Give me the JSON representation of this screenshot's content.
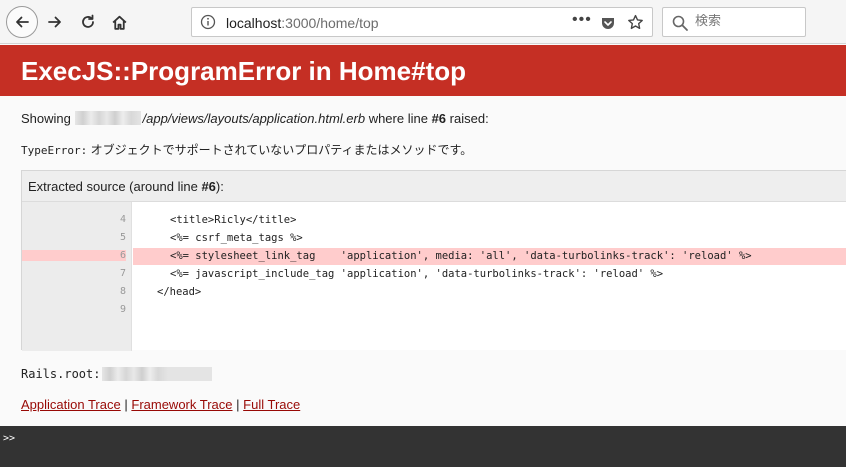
{
  "browser": {
    "url_host": "localhost",
    "url_path": ":3000/home/top",
    "more_label": "•••",
    "search_placeholder": "検索"
  },
  "error": {
    "title": "ExecJS::ProgramError in Home#top",
    "showing_prefix": "Showing",
    "template_path": "/app/views/layouts/application.html.erb",
    "where_text": "where line",
    "line_ref": "#6",
    "raised_text": "raised:",
    "type_label": "TypeError:",
    "message": "オブジェクトでサポートされていないプロパティまたはメソッドです。"
  },
  "source": {
    "caption_prefix": "Extracted source (around line ",
    "caption_line": "#6",
    "caption_suffix": "):",
    "lines": [
      {
        "num": "4",
        "code": "<title>Ricly</title>"
      },
      {
        "num": "5",
        "code": "<%= csrf_meta_tags %>"
      },
      {
        "num": "6",
        "code": "<%= stylesheet_link_tag    'application', media: 'all', 'data-turbolinks-track': 'reload' %>"
      },
      {
        "num": "7",
        "code": "<%= javascript_include_tag 'application', 'data-turbolinks-track': 'reload' %>"
      },
      {
        "num": "8",
        "code": "</head>"
      },
      {
        "num": "9",
        "code": ""
      }
    ],
    "highlight_line": "6"
  },
  "rails_root_label": "Rails.root:",
  "traces": {
    "application": "Application Trace",
    "framework": "Framework Trace",
    "full": "Full Trace",
    "separator": "|"
  },
  "console": {
    "prompt": ">>"
  }
}
